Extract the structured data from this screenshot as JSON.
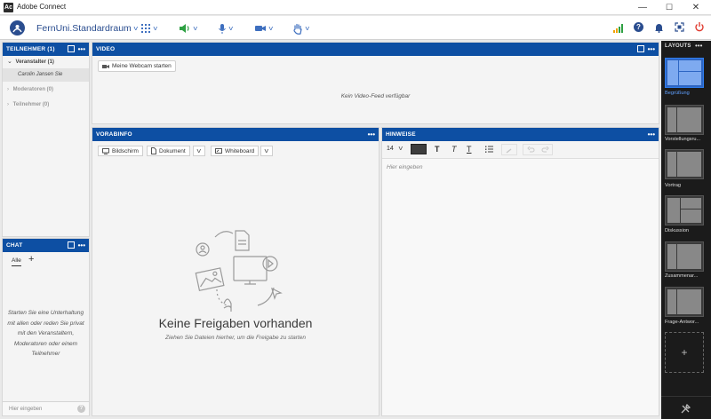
{
  "window": {
    "title": "Adobe Connect",
    "logo_text": "Ac",
    "controls": [
      "—",
      "☐",
      "✕"
    ]
  },
  "toolbar": {
    "room_name": "FernUni.Standardraum",
    "icons": [
      "apps-grid-icon",
      "speaker-icon",
      "microphone-icon",
      "camera-icon",
      "raise-hand-icon",
      "signal-bars-icon",
      "help-icon",
      "bell-icon",
      "fullscreen-icon",
      "power-icon"
    ],
    "help_glyph": "?"
  },
  "participants": {
    "title": "TEILNEHMER (1)",
    "groups": [
      {
        "label": "Veranstalter (1)",
        "expanded": true
      },
      {
        "label": "Moderatoren (0)",
        "expanded": false
      },
      {
        "label": "Teilnehmer (0)",
        "expanded": false
      }
    ],
    "host": {
      "name": "Carolin Jansen",
      "suffix": "Sie"
    }
  },
  "video": {
    "title": "VIDEO",
    "start_button": "Meine Webcam starten",
    "empty_text": "Kein Video-Feed verfügbar"
  },
  "vorabinfo": {
    "title": "VORABINFO",
    "buttons": {
      "screen": "Bildschirm",
      "document": "Dokument",
      "whiteboard": "Whiteboard"
    },
    "empty_title": "Keine Freigaben vorhanden",
    "empty_sub": "Ziehen Sie Dateien hierher, um die Freigabe zu starten"
  },
  "hinweise": {
    "title": "HINWEISE",
    "font_size": "14",
    "placeholder": "Hier eingeben",
    "text_style_glyphs": [
      "T",
      "T",
      "T"
    ]
  },
  "chat": {
    "title": "CHAT",
    "tab_all": "Alle",
    "add_tab_glyph": "+",
    "empty_text": "Starten Sie eine Unterhaltung mit allen oder reden Sie privat mit den Veranstaltern, Moderatoren oder einem Teilnehmer",
    "input_placeholder": "Hier eingeben",
    "help_glyph": "?"
  },
  "layouts": {
    "title": "LAYOUTS",
    "items": [
      {
        "label": "Begrüßung",
        "selected": true
      },
      {
        "label": "Vorstellungsru...",
        "selected": false
      },
      {
        "label": "Vortrag",
        "selected": false
      },
      {
        "label": "Diskussion",
        "selected": false
      },
      {
        "label": "Zusammenar...",
        "selected": false
      },
      {
        "label": "Frage-Antwor...",
        "selected": false
      }
    ],
    "add_glyph": "+"
  },
  "colors": {
    "accent": "#0d4fa3",
    "layout_bg": "#1b1b1b",
    "selected_layout": "#2f7ef0"
  }
}
